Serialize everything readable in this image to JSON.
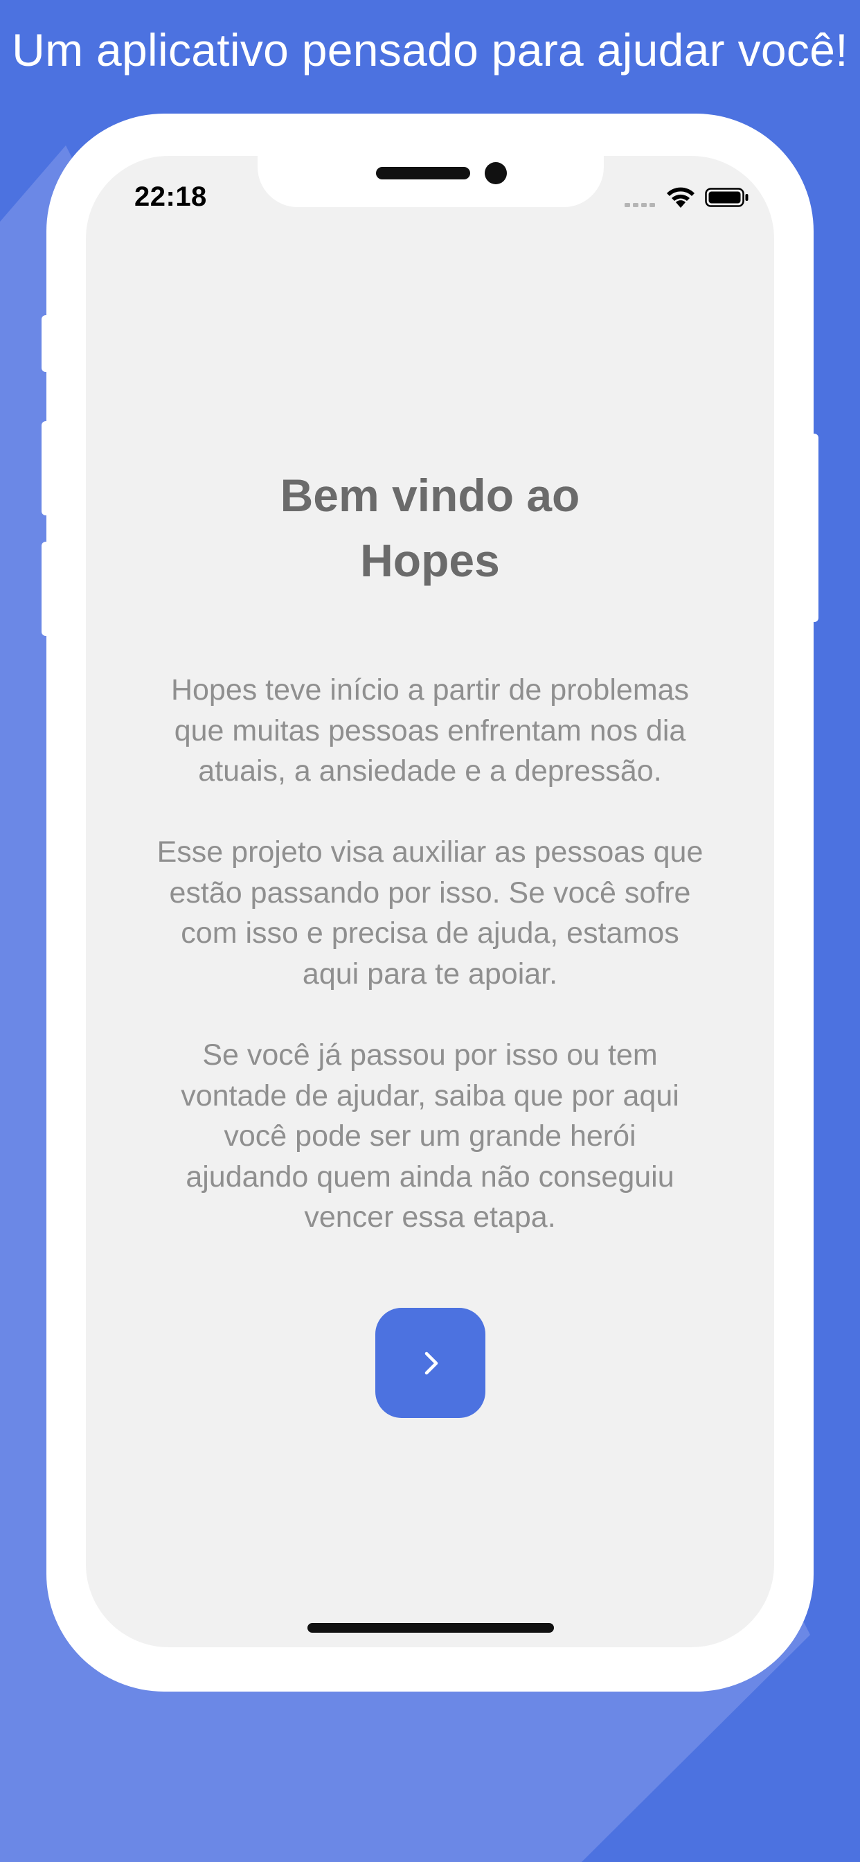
{
  "headline": "Um aplicativo pensado para ajudar você!",
  "status_bar": {
    "time": "22:18"
  },
  "welcome": {
    "title_line1": "Bem vindo ao",
    "title_line2": "Hopes",
    "paragraphs": [
      [
        "Hopes teve início a partir de problemas",
        "que muitas pessoas enfrentam nos dia",
        "atuais, a ansiedade e a depressão."
      ],
      [
        "Esse projeto visa auxiliar as pessoas que",
        "estão passando por isso. Se você sofre",
        "com isso e precisa de ajuda, estamos",
        "aqui para te apoiar."
      ],
      [
        "Se você já passou por isso ou tem",
        "vontade de ajudar, saiba que por aqui",
        "você pode ser um grande herói",
        "ajudando quem ainda não conseguiu",
        "vencer essa etapa."
      ]
    ]
  },
  "next_button": {
    "icon": "chevron-right-icon"
  },
  "colors": {
    "background": "#4c72e0",
    "background_light": "#6b88e6",
    "screen": "#f1f1f1",
    "title_text": "#6b6b6b",
    "body_text": "#8f8f8f",
    "button": "#4c72e0"
  }
}
